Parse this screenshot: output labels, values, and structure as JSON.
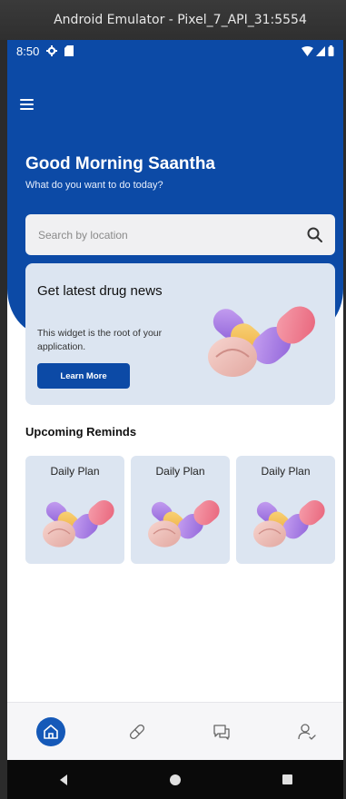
{
  "window": {
    "title": "Android Emulator - Pixel_7_API_31:5554"
  },
  "status_bar": {
    "time": "8:50"
  },
  "header": {
    "greeting": "Good Morning Saantha",
    "subtitle": "What do you want to do today?"
  },
  "search": {
    "placeholder": "Search by location"
  },
  "news_card": {
    "title": "Get latest drug news",
    "text": "This widget is the root of your application.",
    "button_label": "Learn More"
  },
  "reminders": {
    "section_title": "Upcoming Reminds",
    "items": [
      {
        "label": "Daily Plan"
      },
      {
        "label": "Daily Plan"
      },
      {
        "label": "Daily Plan"
      }
    ]
  },
  "bottom_nav": {
    "items": [
      {
        "icon": "home-icon",
        "active": true
      },
      {
        "icon": "pill-icon",
        "active": false
      },
      {
        "icon": "chat-icon",
        "active": false
      },
      {
        "icon": "user-check-icon",
        "active": false
      }
    ]
  },
  "colors": {
    "primary": "#0c4aa6",
    "card_bg": "#dce5f1",
    "nav_active": "#1559b8"
  }
}
